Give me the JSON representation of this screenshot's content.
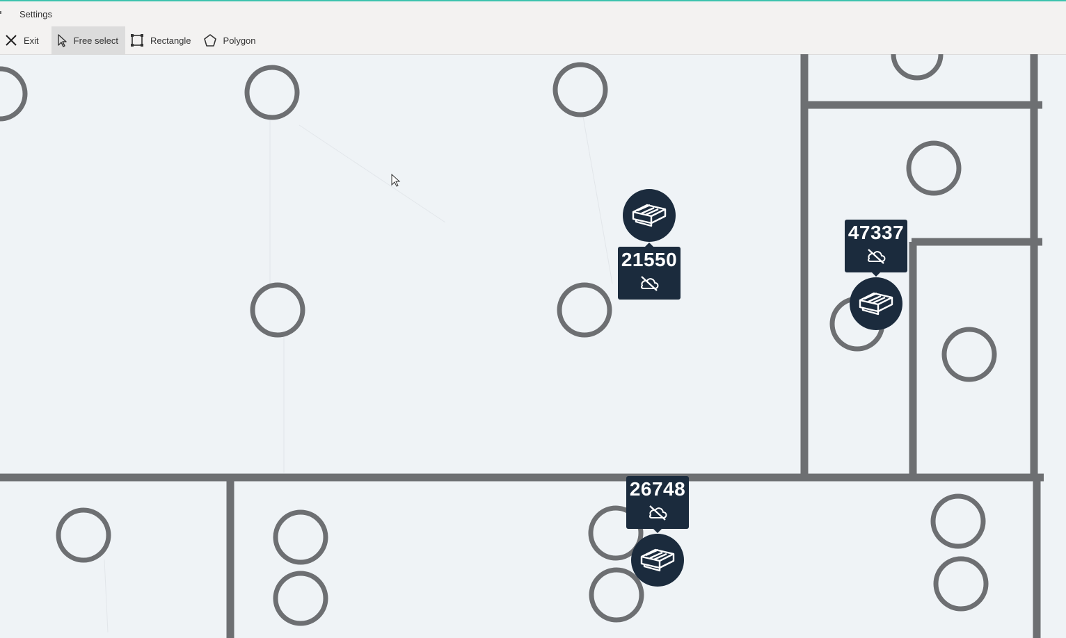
{
  "menubar": {
    "settings_label": "Settings"
  },
  "toolbar": {
    "exit_label": "Exit",
    "free_select_label": "Free select",
    "rectangle_label": "Rectangle",
    "polygon_label": "Polygon",
    "active_tool": "Free select"
  },
  "map": {
    "robots": [
      {
        "id": "21550",
        "status_icon": "cloud-off-icon"
      },
      {
        "id": "47337",
        "status_icon": "cloud-off-icon"
      },
      {
        "id": "26748",
        "status_icon": "cloud-off-icon"
      }
    ]
  },
  "colors": {
    "accent_line": "#3cc3ae",
    "marker": "#1b2b3d",
    "wall": "#6d6f72",
    "map_bg": "#eff3f6"
  }
}
